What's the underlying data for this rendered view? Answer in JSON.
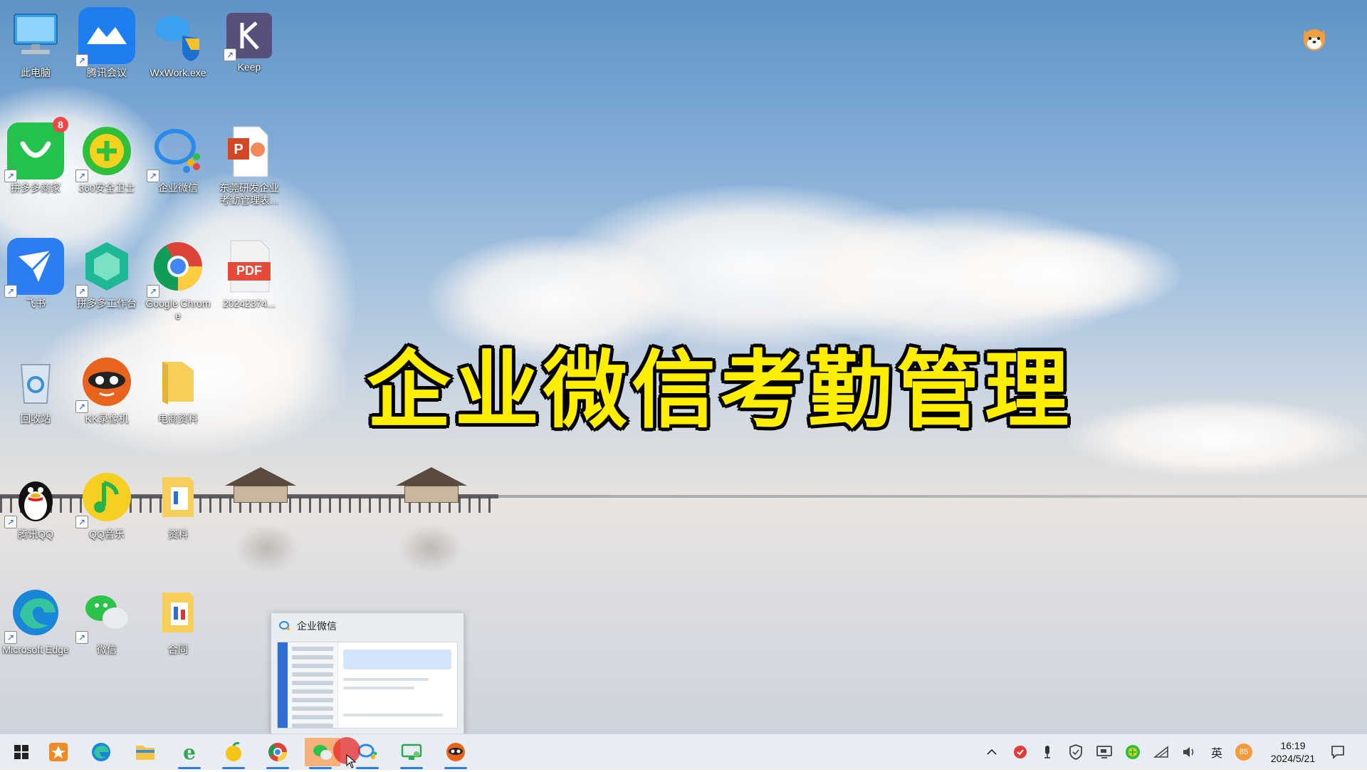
{
  "overlay_title": "企业微信考勤管理",
  "desktop_icons": [
    {
      "label": "此电脑",
      "icon": "computer-icon"
    },
    {
      "label": "腾讯会议",
      "icon": "tencent-meeting-icon"
    },
    {
      "label": "WxWork.exe",
      "icon": "wxwork-exe-icon"
    },
    {
      "label": "Keep",
      "icon": "keep-icon"
    },
    {
      "label": "拼多多商家",
      "icon": "pdd-merchant-icon",
      "badge": "8"
    },
    {
      "label": "360安全卫士",
      "icon": "360-security-icon"
    },
    {
      "label": "企业微信",
      "icon": "wecom-icon"
    },
    {
      "label": "东莞研发企业考勤管理表...",
      "icon": "powerpoint-file-icon"
    },
    {
      "label": "飞书",
      "icon": "feishu-icon"
    },
    {
      "label": "拼多多工作台",
      "icon": "pdd-workbench-icon"
    },
    {
      "label": "Google Chrome",
      "icon": "chrome-icon"
    },
    {
      "label": "20242374...",
      "icon": "pdf-file-icon",
      "file_tag": "PDF"
    },
    {
      "label": "回收站",
      "icon": "recycle-bin-icon"
    },
    {
      "label": "KK录像机",
      "icon": "kk-recorder-icon"
    },
    {
      "label": "电商资料",
      "icon": "folder-icon"
    },
    {
      "label": "腾讯QQ",
      "icon": "qq-icon"
    },
    {
      "label": "QQ音乐",
      "icon": "qq-music-icon"
    },
    {
      "label": "资料",
      "icon": "folder-doc-icon"
    },
    {
      "label": "Microsoft Edge",
      "icon": "edge-icon"
    },
    {
      "label": "微信",
      "icon": "wechat-icon"
    },
    {
      "label": "合同",
      "icon": "folder-doc-icon"
    }
  ],
  "preview": {
    "title": "企业微信"
  },
  "taskbar": {
    "apps": [
      "start-icon",
      "favorites-app-icon",
      "edge-icon",
      "file-explorer-icon",
      "ie-icon",
      "fruit-app-icon",
      "chrome-icon",
      "wechat-icon",
      "wecom-icon",
      "remote-desktop-icon",
      "kk-recorder-icon"
    ],
    "ime_label": "英",
    "battery_badge": "85",
    "time": "16:19",
    "date": "2024/5/21"
  },
  "colors": {
    "overlay_text": "#ffee00",
    "accent": "#2b7de9"
  }
}
